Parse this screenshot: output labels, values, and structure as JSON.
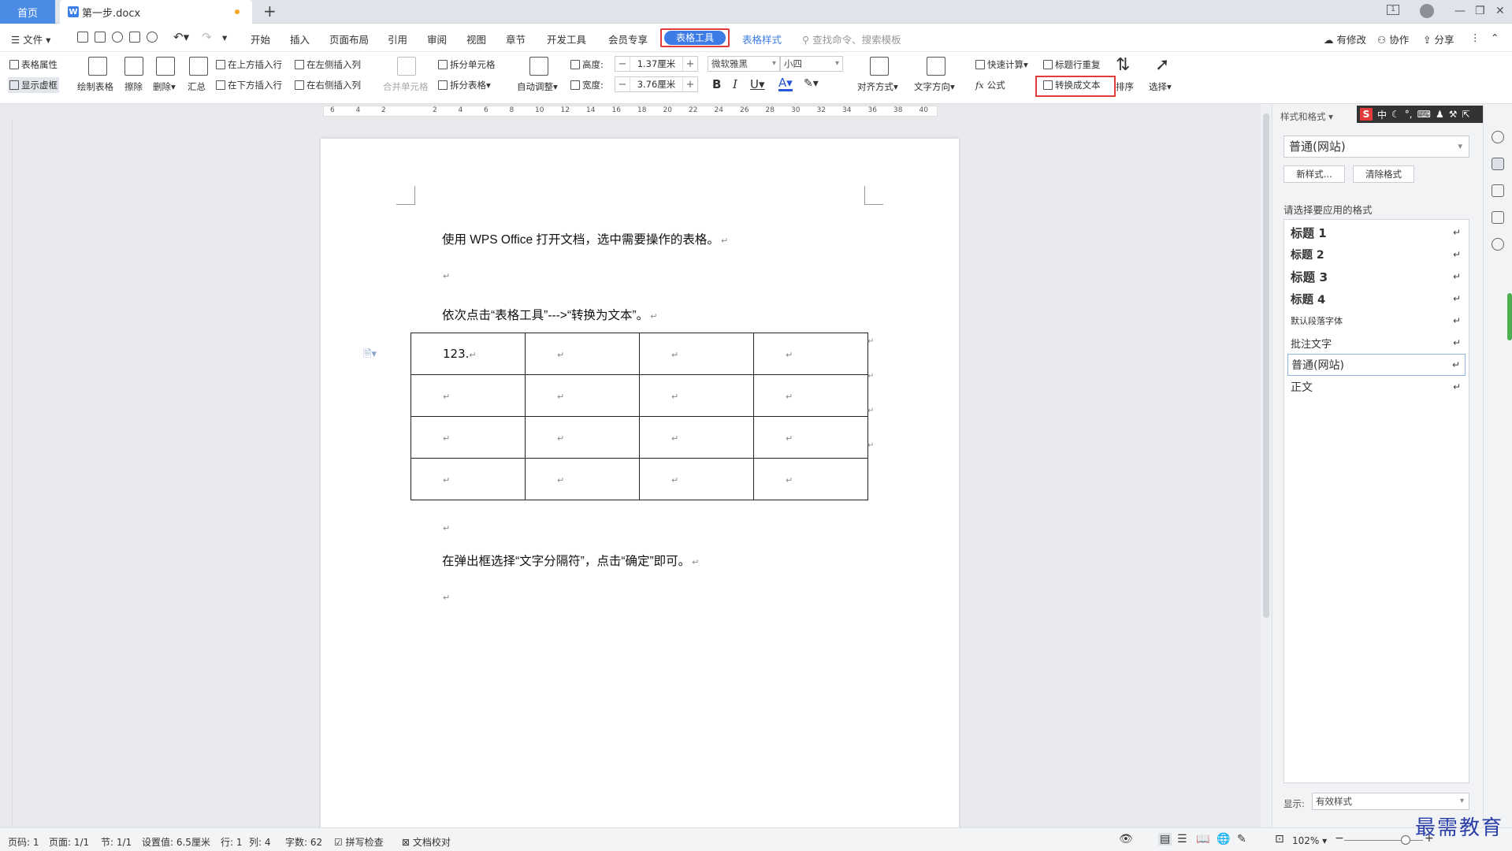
{
  "titlebar": {
    "home_tab": "首页",
    "doc_tab": "第一步.docx",
    "doc_icon": "W",
    "new_tab": "+",
    "counter": "1"
  },
  "menubar": {
    "file": "文件",
    "tabs": [
      "开始",
      "插入",
      "页面布局",
      "引用",
      "审阅",
      "视图",
      "章节",
      "开发工具",
      "会员专享"
    ],
    "active_tab": "表格工具",
    "table_style_tab": "表格样式",
    "search_placeholder": "查找命令、搜索模板",
    "right": {
      "modified": "有修改",
      "collab": "协作",
      "share": "分享"
    }
  },
  "ribbon": {
    "table_props": "表格属性",
    "show_grid": "显示虚框",
    "draw_table": "绘制表格",
    "erase": "擦除",
    "delete": "删除",
    "summary": "汇总",
    "insert_above": "在上方插入行",
    "insert_below": "在下方插入行",
    "insert_left": "在左侧插入列",
    "insert_right": "在右侧插入列",
    "merge_cells": "合并单元格",
    "split_cells": "拆分单元格",
    "split_table": "拆分表格",
    "auto_fit": "自动调整",
    "height_label": "高度:",
    "height_value": "1.37厘米",
    "width_label": "宽度:",
    "width_value": "3.76厘米",
    "font_name": "微软雅黑",
    "font_size": "小四",
    "align": "对齐方式",
    "text_dir": "文字方向",
    "quick_calc": "快速计算",
    "formula": "公式",
    "formula_icon": "fx",
    "repeat_header": "标题行重复",
    "convert_text": "转换成文本",
    "sort": "排序",
    "select": "选择",
    "bold": "B",
    "italic": "I",
    "underline": "U",
    "font_color": "A"
  },
  "ruler": {
    "ticks": [
      "6",
      "4",
      "2",
      "",
      "2",
      "4",
      "6",
      "8",
      "10",
      "12",
      "14",
      "16",
      "18",
      "20",
      "22",
      "24",
      "26",
      "28",
      "30",
      "32",
      "34",
      "36",
      "38",
      "40"
    ]
  },
  "document": {
    "p1": "使用 WPS Office 打开文档，选中需要操作的表格。",
    "p2": "依次点击“表格工具”--->“转换为文本”。",
    "cell_value": "123.",
    "p3": "在弹出框选择“文字分隔符”，点击“确定”即可。",
    "para_mark": "↵"
  },
  "sidepanel": {
    "title": "样式和格式",
    "current_style": "普通(网站)",
    "new_style": "新样式...",
    "clear_format": "清除格式",
    "choose_label": "请选择要应用的格式",
    "styles": [
      {
        "label": "标题  1",
        "size": 15,
        "bold": true
      },
      {
        "label": "标题  2",
        "size": 14,
        "bold": true
      },
      {
        "label": "标题  3",
        "size": 15.5,
        "bold": true
      },
      {
        "label": "标题  4",
        "size": 14.5,
        "bold": true
      },
      {
        "label": "默认段落字体",
        "size": 11,
        "bold": false
      },
      {
        "label": "批注文字",
        "size": 13,
        "bold": false
      },
      {
        "label": "普通(网站)",
        "size": 14,
        "bold": false
      },
      {
        "label": "正文",
        "size": 14,
        "bold": false
      }
    ],
    "selected_index": 6,
    "show_label": "显示:",
    "show_value": "有效样式"
  },
  "ime": {
    "mode": "中",
    "logo": "S"
  },
  "statusbar": {
    "page_num": "页码: 1",
    "pages": "页面: 1/1",
    "section": "节: 1/1",
    "setting": "设置值: 6.5厘米",
    "row": "行: 1",
    "col": "列: 4",
    "words": "字数: 62",
    "spell": "拼写检查",
    "proof": "文档校对",
    "zoom": "102%"
  },
  "watermark": "最需教育",
  "colors": {
    "accent": "#3d7ce7",
    "highlight": "#e23b3b"
  }
}
